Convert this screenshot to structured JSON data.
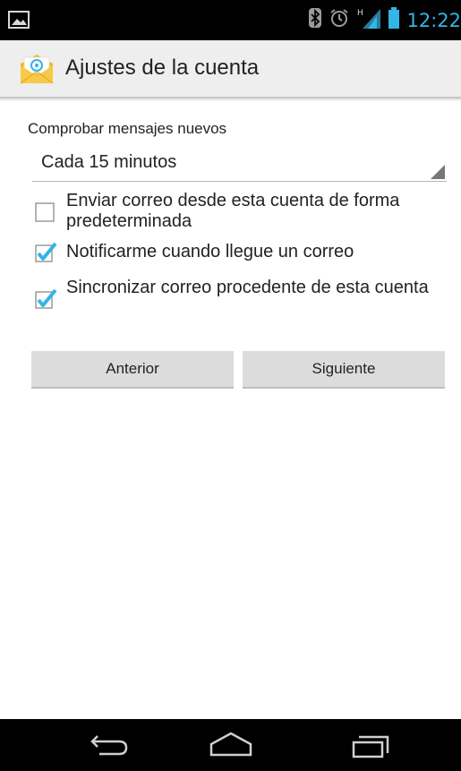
{
  "status_bar": {
    "time": "12:22",
    "icons": [
      "image-icon",
      "bluetooth-icon",
      "alarm-icon",
      "signal-icon",
      "battery-icon"
    ],
    "accent_color": "#33b5e5"
  },
  "action_bar": {
    "title": "Ajustes de la cuenta",
    "icon": "email-app-icon"
  },
  "settings": {
    "check_frequency_label": "Comprobar mensajes nuevos",
    "check_frequency_value": "Cada 15 minutos",
    "options": [
      {
        "label": "Enviar correo desde esta cuenta de forma predeterminada",
        "checked": false
      },
      {
        "label": "Notificarme cuando llegue un correo",
        "checked": true
      },
      {
        "label": "Sincronizar correo procedente de esta cuenta",
        "checked": true
      }
    ]
  },
  "buttons": {
    "previous": "Anterior",
    "next": "Siguiente"
  },
  "nav_bar": {
    "icons": [
      "back-icon",
      "home-icon",
      "recent-apps-icon"
    ]
  }
}
